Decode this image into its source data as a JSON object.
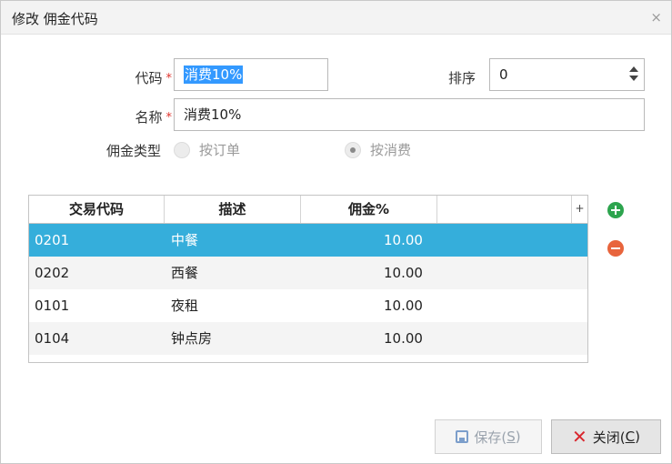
{
  "dialog": {
    "title": "修改 佣金代码",
    "close_glyph": "×"
  },
  "form": {
    "code_label": "代码",
    "code_value": "消费10%",
    "sort_label": "排序",
    "sort_value": "0",
    "name_label": "名称",
    "name_value": "消费10%",
    "type_label": "佣金类型",
    "required_mark": "*",
    "radio_options": [
      {
        "label": "按订单",
        "checked": false
      },
      {
        "label": "按消费",
        "checked": true
      }
    ]
  },
  "table": {
    "headers": [
      "交易代码",
      "描述",
      "佣金%"
    ],
    "add_col_glyph": "+",
    "rows": [
      {
        "code": "0201",
        "desc": "中餐",
        "pct": "10.00",
        "selected": true
      },
      {
        "code": "0202",
        "desc": "西餐",
        "pct": "10.00",
        "selected": false
      },
      {
        "code": "0101",
        "desc": "夜租",
        "pct": "10.00",
        "selected": false
      },
      {
        "code": "0104",
        "desc": "钟点房",
        "pct": "10.00",
        "selected": false
      }
    ]
  },
  "buttons": {
    "save_text": "保存(",
    "save_key": "S",
    "save_end": ")",
    "close_glyph": "✕",
    "close_text": "关闭(",
    "close_key": "C",
    "close_end": ")"
  },
  "colors": {
    "selected_row": "#35aedb",
    "add_icon": "#2da44e",
    "remove_icon": "#e8643c",
    "required": "#e0322b"
  }
}
